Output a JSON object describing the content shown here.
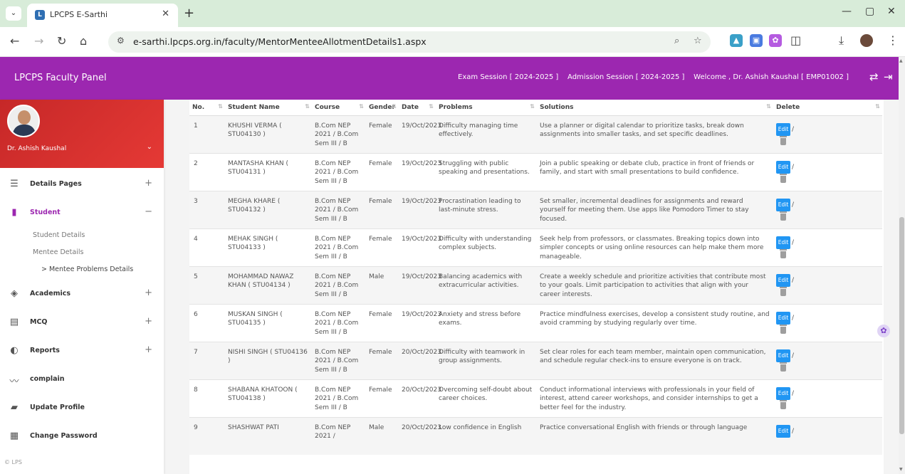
{
  "browser": {
    "tab_title": "LPCPS E-Sarthi",
    "favicon_letter": "L",
    "url": "e-sarthi.lpcps.org.in/faculty/MentorMenteeAllotmentDetails1.aspx"
  },
  "header": {
    "app_title": "LPCPS Faculty Panel",
    "exam_session": "Exam Session [ 2024-2025 ]",
    "admission_session": "Admission Session [ 2024-2025 ]",
    "welcome": "Welcome , Dr. Ashish Kaushal [ EMP01002 ]"
  },
  "sidebar": {
    "profile_name": "Dr. Ashish Kaushal",
    "menu": [
      {
        "label": "Details Pages",
        "sign": "+"
      },
      {
        "label": "Student",
        "sign": "−"
      },
      {
        "label": "Academics",
        "sign": "+"
      },
      {
        "label": "MCQ",
        "sign": "+"
      },
      {
        "label": "Reports",
        "sign": "+"
      },
      {
        "label": "complain",
        "sign": ""
      },
      {
        "label": "Update Profile",
        "sign": ""
      },
      {
        "label": "Change Password",
        "sign": ""
      }
    ],
    "submenu": {
      "student_details": "Student Details",
      "mentee_details": "Mentee Details",
      "mentee_problems": "> Mentee Problems Details"
    },
    "footer": "© LPS"
  },
  "table": {
    "headers": [
      "No.",
      "Student Name",
      "Course",
      "Gender",
      "Date",
      "Problems",
      "Solutions",
      "Delete"
    ],
    "edit_label": "Edit",
    "rows": [
      {
        "no": "1",
        "name": "KHUSHI VERMA ( STU04130 )",
        "course": "B.Com NEP 2021 / B.Com Sem III / B",
        "gender": "Female",
        "date": "19/Oct/2023",
        "problem": "Difficulty managing time effectively.",
        "solution": "Use a planner or digital calendar to prioritize tasks, break down assignments into smaller tasks, and set specific deadlines."
      },
      {
        "no": "2",
        "name": "MANTASHA KHAN ( STU04131 )",
        "course": "B.Com NEP 2021 / B.Com Sem III / B",
        "gender": "Female",
        "date": "19/Oct/2023",
        "problem": "Struggling with public speaking and presentations.",
        "solution": "Join a public speaking or debate club, practice in front of friends or family, and start with small presentations to build confidence."
      },
      {
        "no": "3",
        "name": "MEGHA KHARE ( STU04132 )",
        "course": "B.Com NEP 2021 / B.Com Sem III / B",
        "gender": "Female",
        "date": "19/Oct/2023",
        "problem": "Procrastination leading to last-minute stress.",
        "solution": "Set smaller, incremental deadlines for assignments and reward yourself for meeting them. Use apps like Pomodoro Timer to stay focused."
      },
      {
        "no": "4",
        "name": "MEHAK SINGH ( STU04133 )",
        "course": "B.Com NEP 2021 / B.Com Sem III / B",
        "gender": "Female",
        "date": "19/Oct/2023",
        "problem": "Difficulty with understanding complex subjects.",
        "solution": "Seek help from professors, or classmates. Breaking topics down into simpler concepts or using online resources can help make them more manageable."
      },
      {
        "no": "5",
        "name": "MOHAMMAD NAWAZ KHAN ( STU04134 )",
        "course": "B.Com NEP 2021 / B.Com Sem III / B",
        "gender": "Male",
        "date": "19/Oct/2023",
        "problem": "Balancing academics with extracurricular activities.",
        "solution": "Create a weekly schedule and prioritize activities that contribute most to your goals. Limit participation to activities that align with your career interests."
      },
      {
        "no": "6",
        "name": "MUSKAN SINGH ( STU04135 )",
        "course": "B.Com NEP 2021 / B.Com Sem III / B",
        "gender": "Female",
        "date": "19/Oct/2023",
        "problem": "Anxiety and stress before exams.",
        "solution": "Practice mindfulness exercises, develop a consistent study routine, and avoid cramming by studying regularly over time."
      },
      {
        "no": "7",
        "name": "NISHI SINGH ( STU04136 )",
        "course": "B.Com NEP 2021 / B.Com Sem III / B",
        "gender": "Female",
        "date": "20/Oct/2023",
        "problem": "Difficulty with teamwork in group assignments.",
        "solution": "Set clear roles for each team member, maintain open communication, and schedule regular check-ins to ensure everyone is on track."
      },
      {
        "no": "8",
        "name": "SHABANA KHATOON ( STU04138 )",
        "course": "B.Com NEP 2021 / B.Com Sem III / B",
        "gender": "Female",
        "date": "20/Oct/2023",
        "problem": "Overcoming self-doubt about career choices.",
        "solution": "Conduct informational interviews with professionals in your field of interest, attend career workshops, and consider internships to get a better feel for the industry."
      },
      {
        "no": "9",
        "name": "SHASHWAT PATI",
        "course": "B.Com NEP 2021 /",
        "gender": "Male",
        "date": "20/Oct/2023",
        "problem": "Low confidence in English",
        "solution": "Practice conversational English with friends or through language"
      }
    ]
  }
}
